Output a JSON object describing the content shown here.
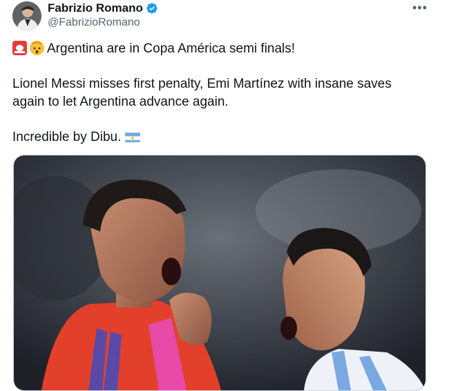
{
  "tweet": {
    "display_name": "Fabrizio Romano",
    "handle": "@FabrizioRomano",
    "more_label": "•••",
    "line1": "Argentina are in Copa América semi finals!",
    "line2": "Lionel Messi misses first penalty, Emi Martínez with insane saves again to let Argentina advance again.",
    "line3": "Incredible by Dibu.",
    "line1_emojis": [
      "police-siren-icon",
      "exploding-head-icon"
    ],
    "line3_emoji": "argentina-flag-icon"
  },
  "colors": {
    "verified": "#1d9bf0",
    "handle": "#536471",
    "text": "#0f1419"
  }
}
